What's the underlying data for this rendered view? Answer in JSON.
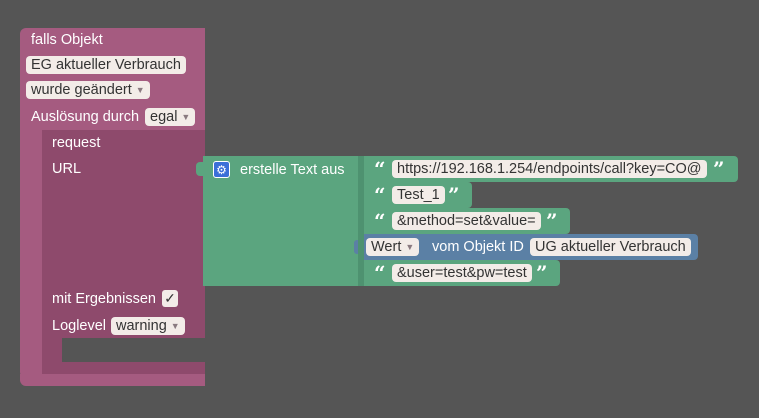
{
  "event_block": {
    "header_label": "falls Objekt",
    "object_field": "EG aktueller Verbrauch",
    "change_dropdown": "wurde geändert",
    "trigger_label": "Auslösung durch",
    "trigger_dropdown": "egal"
  },
  "request_block": {
    "title": "request",
    "url_label": "URL",
    "results_label": "mit Ergebnissen",
    "results_checked": "✓",
    "loglevel_label": "Loglevel",
    "loglevel_dropdown": "warning"
  },
  "text_join_block": {
    "label": "erstelle Text aus",
    "items": [
      {
        "open_quote": "“",
        "value": "https://192.168.1.254/endpoints/call?key=CO@",
        "close_quote": "”"
      },
      {
        "open_quote": "“",
        "value": "Test_1",
        "close_quote": "”"
      },
      {
        "open_quote": "“",
        "value": "&method=set&value=",
        "close_quote": "”"
      }
    ],
    "value_block": {
      "attribute_dropdown": "Wert",
      "of_object_label": "vom Objekt ID",
      "object_field": "UG aktueller Verbrauch"
    },
    "last_item": {
      "open_quote": "“",
      "value": "&user=test&pw=test",
      "close_quote": "”"
    }
  },
  "colors": {
    "workspace": "#555555",
    "event_block": "#a55b80",
    "text_block": "#5ba57f",
    "value_block": "#5b80a5",
    "field_bg": "#f3ece8"
  }
}
